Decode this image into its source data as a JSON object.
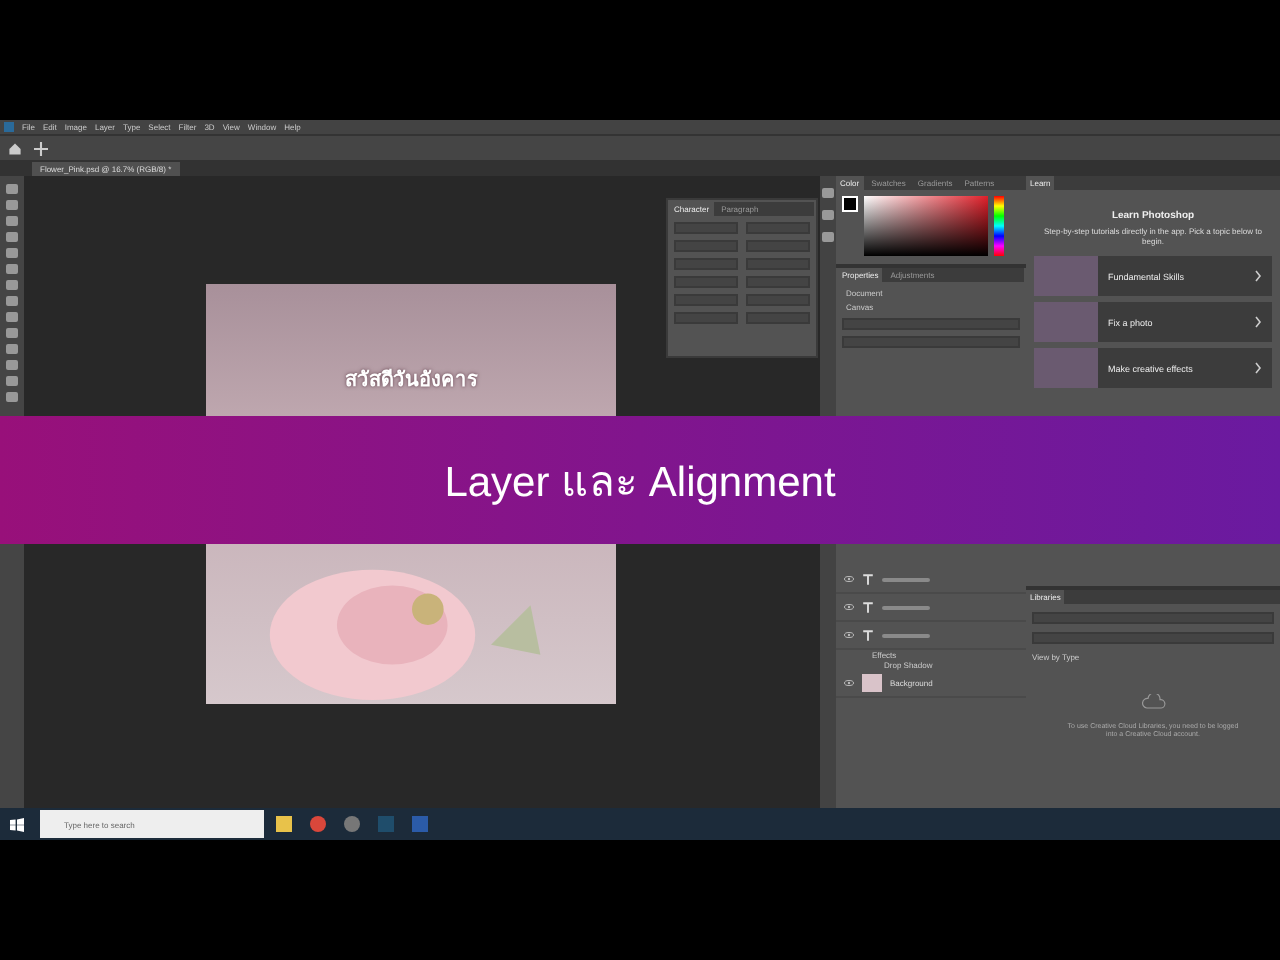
{
  "menu_bar": [
    "File",
    "Edit",
    "Image",
    "Layer",
    "Type",
    "Select",
    "Filter",
    "3D",
    "View",
    "Window",
    "Help"
  ],
  "document_tab": {
    "title": "Flower_Pink.psd @ 16.7% (RGB/8) *"
  },
  "canvas": {
    "heading": "สวัสดีวันอังคาร"
  },
  "character_panel": {
    "tabs": [
      {
        "label": "Character",
        "selected": true
      },
      {
        "label": "Paragraph",
        "selected": false
      }
    ]
  },
  "color_panel": {
    "tabs": [
      {
        "label": "Color",
        "selected": true
      },
      {
        "label": "Swatches",
        "selected": false
      },
      {
        "label": "Gradients",
        "selected": false
      },
      {
        "label": "Patterns",
        "selected": false
      }
    ]
  },
  "properties_panel": {
    "tabs": [
      {
        "label": "Properties",
        "selected": true
      },
      {
        "label": "Adjustments",
        "selected": false
      }
    ],
    "section": "Document",
    "group": "Canvas"
  },
  "layers": [
    {
      "kind": "text"
    },
    {
      "kind": "text"
    },
    {
      "kind": "text",
      "effects": [
        "Effects",
        "Drop Shadow"
      ]
    },
    {
      "kind": "image",
      "name": "Background"
    }
  ],
  "learn_panel": {
    "tab": "Learn",
    "title": "Learn Photoshop",
    "subtitle": "Step-by-step tutorials directly in the app. Pick a topic below to begin.",
    "topics": [
      "Fundamental Skills",
      "Fix a photo",
      "Make creative effects"
    ]
  },
  "libraries_panel": {
    "tab": "Libraries",
    "view_label": "View by Type",
    "message": "To use Creative Cloud Libraries, you need to be logged into a Creative Cloud account."
  },
  "banner": {
    "title": "Layer และ Alignment"
  },
  "taskbar": {
    "search_placeholder": "Type here to search"
  }
}
